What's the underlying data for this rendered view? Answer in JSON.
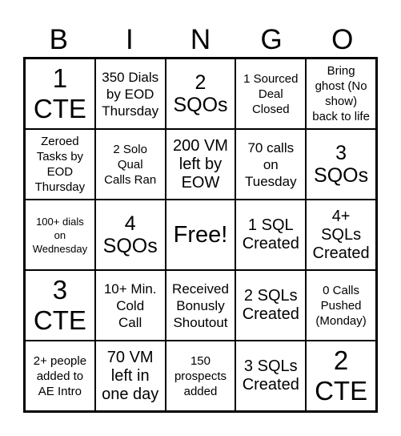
{
  "header": {
    "letters": [
      "B",
      "I",
      "N",
      "G",
      "O"
    ]
  },
  "cells": [
    [
      "1\nCTE",
      "350 Dials\nby EOD\nThursday",
      "2\nSQOs",
      "1 Sourced\nDeal\nClosed",
      "Bring\nghost (No\nshow)\nback to life"
    ],
    [
      "Zeroed\nTasks by\nEOD\nThursday",
      "2 Solo\nQual\nCalls Ran",
      "200 VM\nleft by\nEOW",
      "70 calls\non\nTuesday",
      "3\nSQOs"
    ],
    [
      "100+ dials\non\nWednesday",
      "4\nSQOs",
      "Free!",
      "1 SQL\nCreated",
      "4+\nSQLs\nCreated"
    ],
    [
      "3\nCTE",
      "10+ Min.\nCold\nCall",
      "Received\nBonusly\nShoutout",
      "2 SQLs\nCreated",
      "0 Calls\nPushed\n(Monday)"
    ],
    [
      "2+ people\nadded to\nAE Intro",
      "70 VM\nleft in\none day",
      "150\nprospects\nadded",
      "3 SQLs\nCreated",
      "2\nCTE"
    ]
  ]
}
